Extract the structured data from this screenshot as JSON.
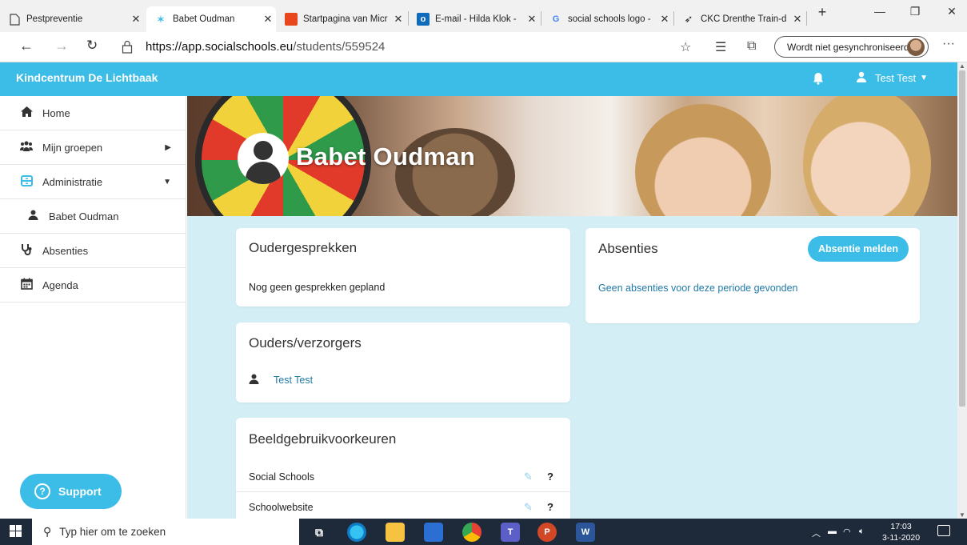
{
  "browser": {
    "tabs": [
      {
        "label": "Pestpreventie",
        "icon": "document-icon"
      },
      {
        "label": "Babet Oudman",
        "icon": "socialschools-star-icon"
      },
      {
        "label": "Startpagina van Micr",
        "icon": "office-icon"
      },
      {
        "label": "E-mail - Hilda Klok -",
        "icon": "outlook-icon"
      },
      {
        "label": "social schools logo -",
        "icon": "google-icon"
      },
      {
        "label": "CKC Drenthe Train-d",
        "icon": "rocket-icon"
      }
    ],
    "url_host": "https://app.socialschools.eu",
    "url_path": "/students/559524",
    "sync_label": "Wordt niet gesynchroniseerd"
  },
  "header": {
    "title": "Kindcentrum De Lichtbaak",
    "user_name": "Test Test"
  },
  "sidebar": {
    "items": [
      {
        "label": "Home",
        "icon": "home-icon"
      },
      {
        "label": "Mijn groepen",
        "icon": "group-icon"
      },
      {
        "label": "Administratie",
        "icon": "archive-icon"
      },
      {
        "label": "Babet Oudman",
        "icon": "person-icon"
      },
      {
        "label": "Absenties",
        "icon": "stethoscope-icon"
      },
      {
        "label": "Agenda",
        "icon": "calendar-icon"
      }
    ],
    "support_label": "Support"
  },
  "profile": {
    "name": "Babet Oudman"
  },
  "cards": {
    "oudergesprekken": {
      "title": "Oudergesprekken",
      "text": "Nog geen gesprekken gepland"
    },
    "ouders": {
      "title": "Ouders/verzorgers",
      "parent_name": "Test Test"
    },
    "beeldgebruik": {
      "title": "Beeldgebruikvoorkeuren",
      "rows": [
        {
          "label": "Social Schools"
        },
        {
          "label": "Schoolwebsite"
        }
      ]
    },
    "absenties": {
      "title": "Absenties",
      "button_label": "Absentie melden",
      "empty_text": "Geen absenties voor deze periode gevonden"
    }
  },
  "taskbar": {
    "search_placeholder": "Typ hier om te zoeken",
    "time": "17:03",
    "date": "3-11-2020"
  },
  "colors": {
    "accent": "#3cbde8",
    "main_bg": "#d3eff5",
    "link": "#1f7aa8",
    "taskbar": "#1e2a3a"
  }
}
